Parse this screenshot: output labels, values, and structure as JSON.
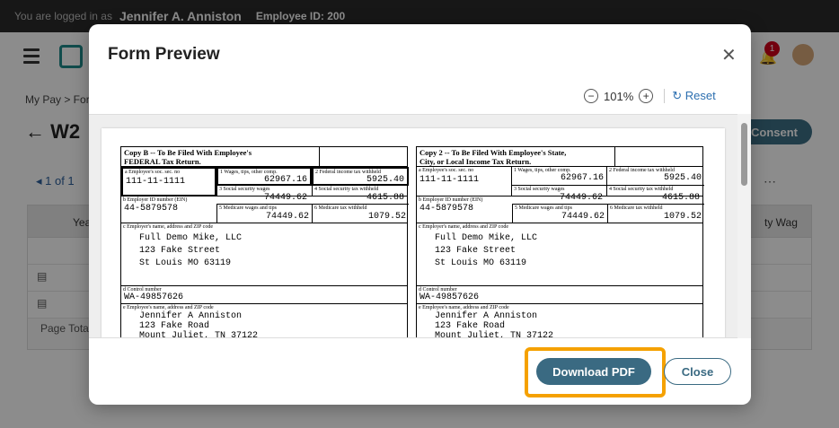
{
  "topbar": {
    "logged_in_label": "You are logged in as",
    "user_name": "Jennifer A. Anniston",
    "employee_id": "Employee ID: 200"
  },
  "header": {
    "notification_count": "1"
  },
  "breadcrumb": "My Pay > Form",
  "page_title": "W2",
  "consent_label": "Consent",
  "pager_label": "1 of 1",
  "table": {
    "col_year": "Yea",
    "col_wages": "ty Wag",
    "page_total": "Page Total"
  },
  "modal": {
    "title": "Form Preview",
    "zoom": "101%",
    "reset_label": "Reset",
    "download_label": "Download PDF",
    "close_label": "Close"
  },
  "w2": {
    "copy_b": {
      "title1": "Copy B -- To Be Filed With Employee's",
      "title2": "FEDERAL Tax Return."
    },
    "copy_2": {
      "title1": "Copy 2 -- To Be Filed With Employee's State,",
      "title2": "City, or Local Income Tax Return."
    },
    "ssn_label": "a Employee's soc. sec. no",
    "ssn": "111-11-1111",
    "ein_label": "b Employer ID number (EIN)",
    "ein": "44-5879578",
    "box1_label": "1 Wages, tips, other comp.",
    "box1": "62967.16",
    "box2_label": "2 Federal income tax withheld",
    "box2": "5925.40",
    "box3_label": "3 Social security wages",
    "box3": "74449.62",
    "box4_label": "4 Social security tax withheld",
    "box4": "4615.88",
    "box5_label": "5 Medicare wages and tips",
    "box5": "74449.62",
    "box6_label": "6 Medicare tax withheld",
    "box6": "1079.52",
    "employer_label": "c Employer's name, address and ZIP code",
    "employer_line1": "Full Demo Mike, LLC",
    "employer_line2": "123 Fake Street",
    "employer_line3": "St Louis MO 63119",
    "control_label": "d Control number",
    "control": "WA-49857626",
    "employee_label": "e Employee's name, address and ZIP code",
    "employee_line1": "Jennifer A Anniston",
    "employee_line2": "123 Fake Road",
    "employee_line3": "Mount Juliet, TN 37122"
  },
  "colors": {
    "accent": "#3a6a82",
    "highlight": "#f5a100",
    "topbar": "#2b2b2b"
  }
}
